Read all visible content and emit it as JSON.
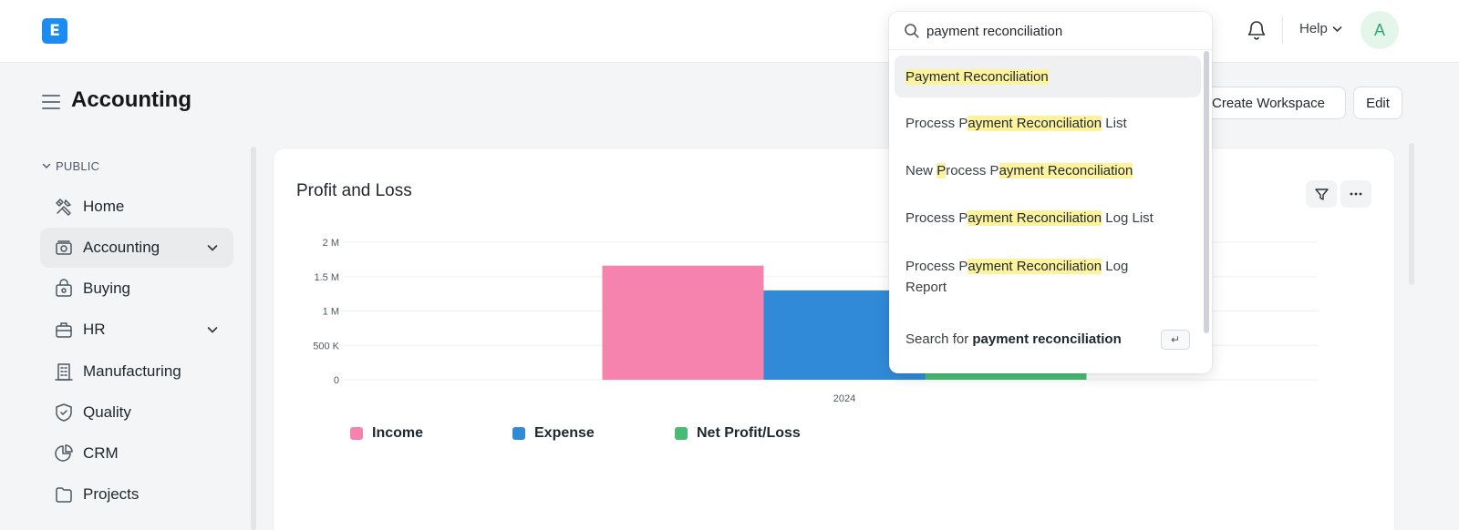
{
  "navbar": {
    "logo_letter": "E",
    "help_label": "Help",
    "avatar_initial": "A"
  },
  "search": {
    "query": "payment reconciliation",
    "results": [
      {
        "parts": [
          {
            "t": "Payment Reconciliation",
            "h": true
          }
        ]
      },
      {
        "parts": [
          {
            "t": "Process P",
            "h": false
          },
          {
            "t": "ayment Reconciliation",
            "h": true
          },
          {
            "t": " List",
            "h": false
          }
        ]
      },
      {
        "parts": [
          {
            "t": "New ",
            "h": false
          },
          {
            "t": "P",
            "h": true
          },
          {
            "t": "rocess P",
            "h": false
          },
          {
            "t": "ayment Reconciliation",
            "h": true
          }
        ]
      },
      {
        "parts": [
          {
            "t": "Process P",
            "h": false
          },
          {
            "t": "ayment Reconciliation",
            "h": true
          },
          {
            "t": " Log List",
            "h": false
          }
        ]
      },
      {
        "parts": [
          {
            "t": "Process P",
            "h": false
          },
          {
            "t": "ayment Reconciliation",
            "h": true
          },
          {
            "t": " Log Report",
            "h": false
          }
        ]
      }
    ],
    "search_for_prefix": "Search for ",
    "search_for_term": "payment reconciliation",
    "enter_key_glyph": "↵"
  },
  "page": {
    "title": "Accounting",
    "create_workspace_label": "Create Workspace",
    "edit_label": "Edit"
  },
  "sidebar": {
    "section_label": "PUBLIC",
    "items": [
      {
        "label": "Home",
        "icon": "tools-icon",
        "active": false,
        "expandable": false
      },
      {
        "label": "Accounting",
        "icon": "accounting-icon",
        "active": true,
        "expandable": true
      },
      {
        "label": "Buying",
        "icon": "buying-icon",
        "active": false,
        "expandable": false
      },
      {
        "label": "HR",
        "icon": "hr-icon",
        "active": false,
        "expandable": true
      },
      {
        "label": "Manufacturing",
        "icon": "building-icon",
        "active": false,
        "expandable": false
      },
      {
        "label": "Quality",
        "icon": "quality-icon",
        "active": false,
        "expandable": false
      },
      {
        "label": "CRM",
        "icon": "crm-icon",
        "active": false,
        "expandable": false
      },
      {
        "label": "Projects",
        "icon": "folder-icon",
        "active": false,
        "expandable": false
      }
    ]
  },
  "card": {
    "title": "Profit and Loss"
  },
  "chart_data": {
    "type": "bar",
    "title": "Profit and Loss",
    "categories": [
      "2024"
    ],
    "series": [
      {
        "name": "Income",
        "values": [
          1660000
        ],
        "color": "#f683ae"
      },
      {
        "name": "Expense",
        "values": [
          1300000
        ],
        "color": "#318ad8"
      },
      {
        "name": "Net Profit/Loss",
        "values": [
          360000
        ],
        "color": "#48bb74"
      }
    ],
    "y_ticks": [
      {
        "value": 0,
        "label": "0"
      },
      {
        "value": 500000,
        "label": "500 K"
      },
      {
        "value": 1000000,
        "label": "1 M"
      },
      {
        "value": 1500000,
        "label": "1.5 M"
      },
      {
        "value": 2000000,
        "label": "2 M"
      }
    ],
    "ylim": [
      0,
      2000000
    ],
    "grid": true,
    "legend_position": "bottom-left"
  }
}
